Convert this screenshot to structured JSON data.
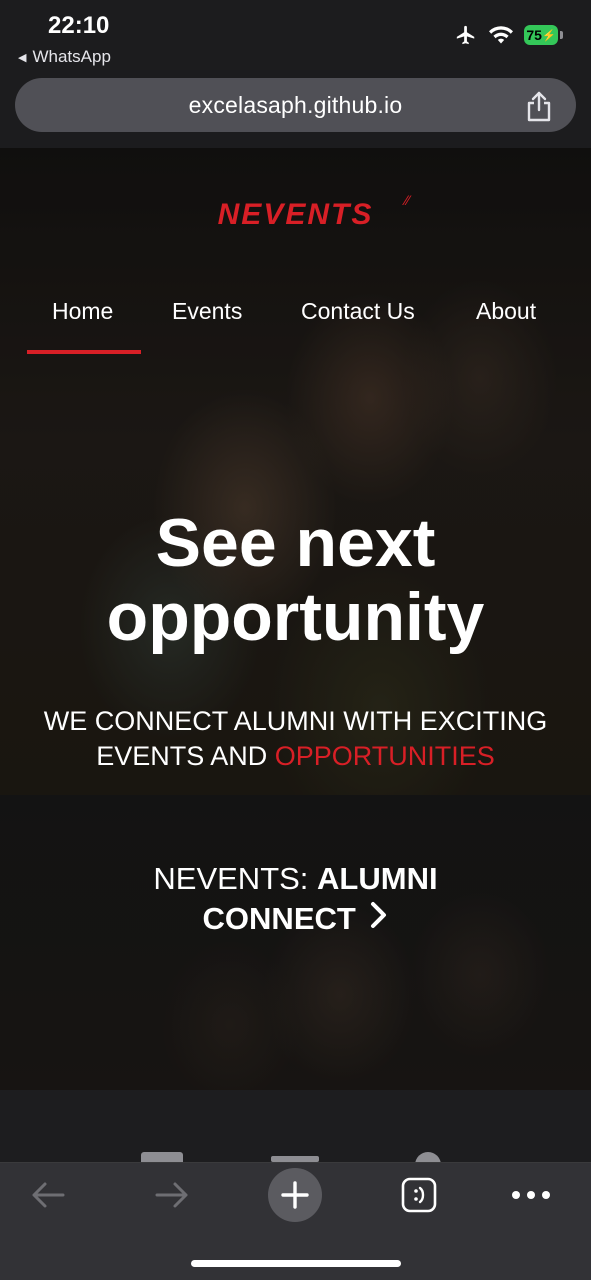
{
  "status_bar": {
    "time": "22:10",
    "back_app": "WhatsApp",
    "battery": "75"
  },
  "browser": {
    "url": "excelasaph.github.io"
  },
  "site": {
    "logo": "NEVENTS",
    "nav": [
      {
        "label": "Home",
        "active": true
      },
      {
        "label": "Events",
        "active": false
      },
      {
        "label": "Contact Us",
        "active": false
      },
      {
        "label": "About",
        "active": false
      }
    ],
    "headline_line1": "See next",
    "headline_line2": "opportunity",
    "subline_line1": "WE CONNECT ALUMNI WITH EXCITING",
    "subline_line2_prefix": "EVENTS AND",
    "subline_line2_accent": "OPPORTUNITIES",
    "tagline_prefix": "NEVENTS:",
    "tagline_bold1": "ALUMNI",
    "tagline_bold2": "CONNECT",
    "accent_color": "#d81f26"
  },
  "icons": [
    "share-icon",
    "airplane-icon",
    "wifi-icon",
    "battery-icon",
    "back-arrow-icon",
    "forward-arrow-icon",
    "plus-icon",
    "tabs-icon",
    "more-icon",
    "chevron-right-icon"
  ]
}
